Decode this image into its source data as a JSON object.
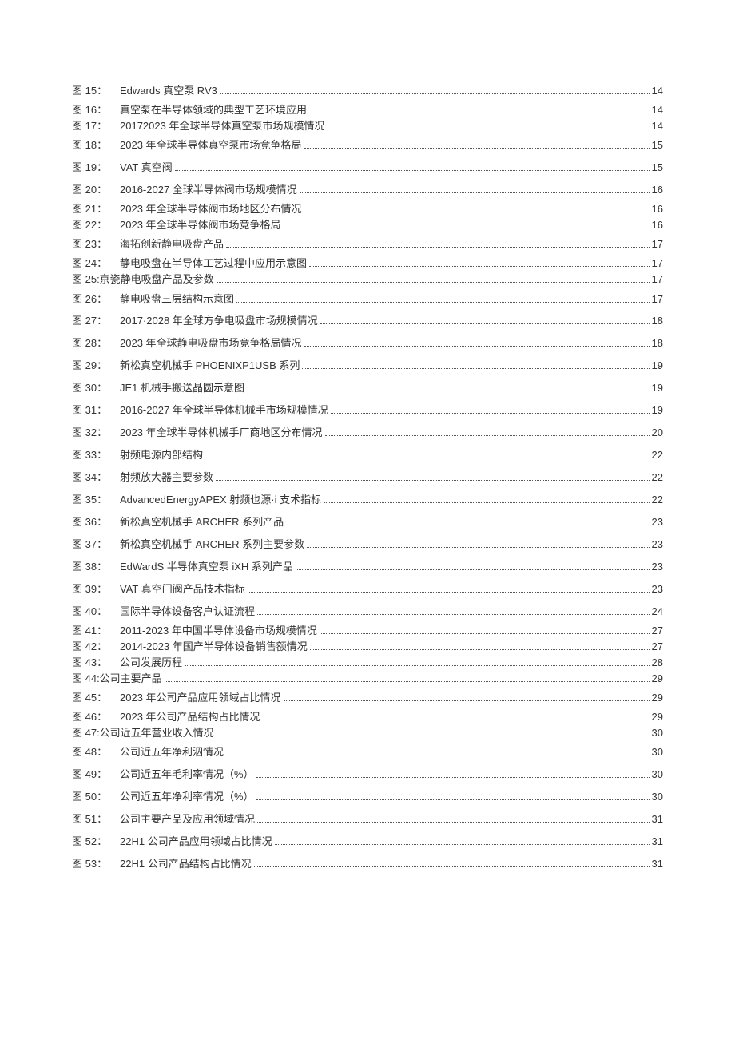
{
  "toc": [
    {
      "label": "图 15：",
      "title": "Edwards 真空泵 RV3 ",
      "page": "14",
      "wide": true
    },
    {
      "label": "图 16：",
      "title": "真空泵在半导体领域的典型工艺环境应用 ",
      "page": " 14",
      "wide": true,
      "tight": true
    },
    {
      "label": "图 17：",
      "title": " 20172023 年全球半导体真空泵市场规模情况 ",
      "page": " 14",
      "wide": true,
      "tight": true
    },
    {
      "label": "图 18：",
      "title": " 2023 年全球半导体真空泵市场竞争格局",
      "page": " 15",
      "wide": true
    },
    {
      "label": "图 19：",
      "title": " VAT 真空阀 ",
      "page": " 15",
      "wide": true
    },
    {
      "label": "图 20：",
      "title": " 2016-2027 全球半导体阀市场规模情况",
      "page": " 16",
      "wide": true
    },
    {
      "label": "图 21：",
      "title": " 2023 年全球半导体阀市场地区分布情况 ",
      "page": " 16",
      "wide": true,
      "tight": true
    },
    {
      "label": "图 22：",
      "title": " 2023 年全球半导体阀市场竞争格局",
      "page": " 16",
      "wide": true,
      "tight": true
    },
    {
      "label": "图 23：",
      "title": "海拓创新静电吸盘产品 ",
      "page": " 17",
      "wide": true
    },
    {
      "label": "图 24：",
      "title": "静电吸盘在半导体工艺过程中应用示意图",
      "page": " 17",
      "wide": true,
      "tight": true
    },
    {
      "label": "图 25:京瓷静电吸盘产品及参数",
      "title": "",
      "page": " 17",
      "noindent": true,
      "tight": true
    },
    {
      "label": "图 26：",
      "title": "静电吸盘三层结构示意图 ",
      "page": " 17",
      "wide": true
    },
    {
      "label": "图 27：",
      "title": " 2017·2028 年全球方争电吸盘市场规模情况",
      "page": " 18",
      "wide": true
    },
    {
      "label": "图 28：",
      "title": " 2023 年全球静电吸盘市场竞争格局情况 ",
      "page": " 18",
      "wide": true
    },
    {
      "label": "图 29：",
      "title": "新松真空机械手 PHOENIXP1USB 系列",
      "page": " 19",
      "wide": true
    },
    {
      "label": "图 30：",
      "title": " JE1 机械手搬送晶圆示意图 ",
      "page": " 19",
      "wide": true
    },
    {
      "label": "图 31：",
      "title": " 2016-2027 年全球半导体机械手市场规模情况 ",
      "page": " 19",
      "wide": true
    },
    {
      "label": "图 32：",
      "title": " 2023 年全球半导体机械手厂商地区分布情况",
      "page": " 20",
      "wide": true
    },
    {
      "label": "图 33：",
      "title": "射频电源内部结构 ",
      "page": " 22",
      "wide": true
    },
    {
      "label": "图 34：",
      "title": "射频放大器主要参数",
      "page": " 22",
      "wide": true
    },
    {
      "label": "图 35：",
      "title": " AdvancedEnergyAPEX 射频也源·i 支术指标 ",
      "page": " 22",
      "wide": true
    },
    {
      "label": "图 36：",
      "title": "新松真空机械手 ARCHER 系列产品 ",
      "page": " 23",
      "wide": true
    },
    {
      "label": "图 37：",
      "title": "新松真空机械手 ARCHER 系列主要参数 ",
      "page": " 23",
      "wide": true
    },
    {
      "label": "图 38：",
      "title": " EdWardS 半导体真空泵 iXH 系列产品 ",
      "page": " 23",
      "wide": true
    },
    {
      "label": "图 39：",
      "title": " VAT 真空门阀产品技术指标",
      "page": " 23",
      "wide": true
    },
    {
      "label": "图 40：",
      "title": "国际半导体设备客户认证流程 ",
      "page": " 24",
      "wide": true
    },
    {
      "label": "图 41：",
      "title": " 2011-2023 年中国半导体设备市场规模情况",
      "page": " 27",
      "wide": true,
      "tight": true
    },
    {
      "label": "图 42：",
      "title": " 2014-2023 年国产半导体设备销售额情况",
      "page": " 27",
      "wide": true,
      "tight": true
    },
    {
      "label": "图 43：",
      "title": "公司发展历程 ",
      "page": " 28",
      "wide": true,
      "tight": true
    },
    {
      "label": "图 44:公司主要产品",
      "title": "",
      "page": " 29",
      "noindent": true,
      "tight": true
    },
    {
      "label": "图 45：",
      "title": " 2023 年公司产品应用领域占比情况 ",
      "page": " 29",
      "wide": true
    },
    {
      "label": "图 46：",
      "title": " 2023 年公司产品结构占比情况 ",
      "page": " 29",
      "wide": true,
      "tight": true
    },
    {
      "label": "图 47:公司近五年营业收入情况",
      "title": "",
      "page": " 30",
      "noindent": true,
      "tight": true
    },
    {
      "label": "图 48：",
      "title": "公司近五年净利泅情况",
      "page": " 30",
      "wide": true
    },
    {
      "label": "图 49：",
      "title": "公司近五年毛利率情况（%）",
      "page": " 30",
      "wide": true
    },
    {
      "label": "图 50：",
      "title": "公司近五年净利率情况（%）",
      "page": " 30",
      "wide": true
    },
    {
      "label": "图 51：",
      "title": "公司主要产品及应用领域情况",
      "page": " 31",
      "wide": true
    },
    {
      "label": "图 52：",
      "title": " 22H1 公司产品应用领域占比情况",
      "page": " 31",
      "wide": true
    },
    {
      "label": "图 53：",
      "title": " 22H1 公司产品结构占比情况",
      "page": " 31",
      "wide": true
    }
  ]
}
